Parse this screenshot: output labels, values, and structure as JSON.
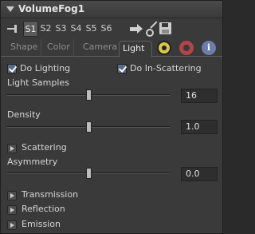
{
  "title": "VolumeFog1",
  "slots": [
    "S1",
    "S2",
    "S3",
    "S4",
    "S5",
    "S6"
  ],
  "active_slot": "S1",
  "tabs": [
    "Shape",
    "Color",
    "Camera",
    "Light"
  ],
  "active_tab": "Light",
  "controls": {
    "do_lighting": {
      "label": "Do Lighting",
      "checked": true
    },
    "do_in_scattering": {
      "label": "Do In-Scattering",
      "checked": true
    },
    "light_samples": {
      "label": "Light Samples",
      "value": "16",
      "fraction": 0.5
    },
    "density": {
      "label": "Density",
      "value": "1.0",
      "fraction": 0.5
    },
    "scattering": {
      "label": "Scattering"
    },
    "asymmetry": {
      "label": "Asymmetry",
      "value": "0.0",
      "fraction": 0.5
    },
    "transmission": {
      "label": "Transmission"
    },
    "reflection": {
      "label": "Reflection"
    },
    "emission": {
      "label": "Emission"
    }
  },
  "icons": {
    "collapse": "triangle-down-icon",
    "pin": "pin-icon",
    "view": "arrow-right-icon",
    "key": "key-icon",
    "save": "save-icon",
    "radiation": "radiation-icon",
    "settings": "gear-icon",
    "info": "info-icon"
  },
  "info_glyph": "i"
}
